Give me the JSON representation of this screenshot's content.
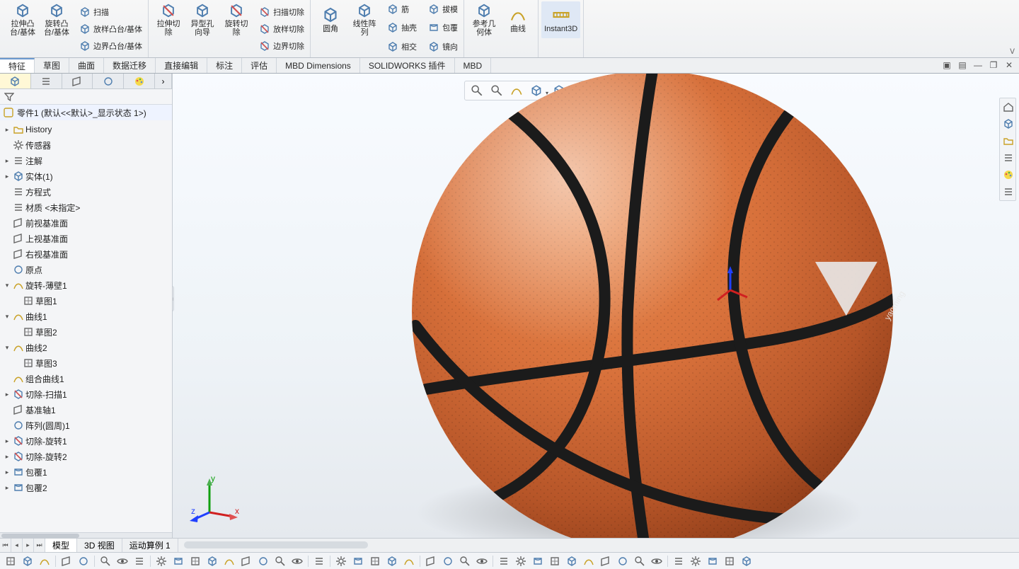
{
  "ribbon": {
    "groups": [
      {
        "big": [
          {
            "id": "extrude-boss",
            "label": "拉伸凸\n台/基体"
          },
          {
            "id": "revolve-boss",
            "label": "旋转凸\n台/基体"
          }
        ],
        "small": [
          {
            "id": "sweep",
            "label": "扫描"
          },
          {
            "id": "loft",
            "label": "放样凸台/基体"
          },
          {
            "id": "boundary",
            "label": "边界凸台/基体"
          }
        ]
      },
      {
        "big": [
          {
            "id": "extrude-cut",
            "label": "拉伸切\n除"
          },
          {
            "id": "hole-wizard",
            "label": "异型孔\n向导"
          },
          {
            "id": "revolve-cut",
            "label": "旋转切\n除"
          }
        ],
        "small": [
          {
            "id": "sweep-cut",
            "label": "扫描切除"
          },
          {
            "id": "loft-cut",
            "label": "放样切除"
          },
          {
            "id": "boundary-cut",
            "label": "边界切除"
          }
        ]
      },
      {
        "big": [
          {
            "id": "fillet",
            "label": "圆角"
          },
          {
            "id": "linear-pattern",
            "label": "线性阵\n列"
          }
        ],
        "small": [
          {
            "id": "rib",
            "label": "筋"
          },
          {
            "id": "draft",
            "label": "拔模"
          },
          {
            "id": "shell",
            "label": "抽壳"
          },
          {
            "id": "wrap",
            "label": "包覆"
          },
          {
            "id": "intersect",
            "label": "相交"
          },
          {
            "id": "mirror",
            "label": "镜向"
          }
        ]
      },
      {
        "big": [
          {
            "id": "ref-geom",
            "label": "参考几\n何体"
          },
          {
            "id": "curves",
            "label": "曲线"
          }
        ],
        "small": []
      },
      {
        "big": [
          {
            "id": "instant3d",
            "label": "Instant3D"
          }
        ],
        "small": [],
        "active": true
      }
    ]
  },
  "tabs": [
    "特征",
    "草图",
    "曲面",
    "数据迁移",
    "直接编辑",
    "标注",
    "评估",
    "MBD Dimensions",
    "SOLIDWORKS 插件",
    "MBD"
  ],
  "activeTab": 0,
  "panelTabs": [
    "feature-tree",
    "property",
    "config",
    "display",
    "appearance"
  ],
  "rootNode": "零件1  (默认<<默认>_显示状态 1>)",
  "tree": [
    {
      "d": 0,
      "tw": "▸",
      "ic": "history",
      "t": "History"
    },
    {
      "d": 0,
      "tw": "",
      "ic": "sensor",
      "t": "传感器"
    },
    {
      "d": 0,
      "tw": "▸",
      "ic": "annot",
      "t": "注解"
    },
    {
      "d": 0,
      "tw": "▸",
      "ic": "solid",
      "t": "实体(1)"
    },
    {
      "d": 0,
      "tw": "",
      "ic": "eqn",
      "t": "方程式"
    },
    {
      "d": 0,
      "tw": "",
      "ic": "mat",
      "t": "材质 <未指定>"
    },
    {
      "d": 0,
      "tw": "",
      "ic": "plane",
      "t": "前视基准面"
    },
    {
      "d": 0,
      "tw": "",
      "ic": "plane",
      "t": "上视基准面"
    },
    {
      "d": 0,
      "tw": "",
      "ic": "plane",
      "t": "右视基准面"
    },
    {
      "d": 0,
      "tw": "",
      "ic": "origin",
      "t": "原点"
    },
    {
      "d": 0,
      "tw": "▾",
      "ic": "revolve",
      "t": "旋转-薄壁1"
    },
    {
      "d": 1,
      "tw": "",
      "ic": "sketch",
      "t": "草图1"
    },
    {
      "d": 0,
      "tw": "▾",
      "ic": "curve",
      "t": "曲线1"
    },
    {
      "d": 1,
      "tw": "",
      "ic": "sketch",
      "t": "草图2"
    },
    {
      "d": 0,
      "tw": "▾",
      "ic": "curve",
      "t": "曲线2"
    },
    {
      "d": 1,
      "tw": "",
      "ic": "sketch",
      "t": "草图3"
    },
    {
      "d": 0,
      "tw": "",
      "ic": "comp",
      "t": "组合曲线1"
    },
    {
      "d": 0,
      "tw": "▸",
      "ic": "cut",
      "t": "切除-扫描1"
    },
    {
      "d": 0,
      "tw": "",
      "ic": "axis",
      "t": "基准轴1"
    },
    {
      "d": 0,
      "tw": "",
      "ic": "circ",
      "t": "阵列(圆周)1"
    },
    {
      "d": 0,
      "tw": "▸",
      "ic": "cutrev",
      "t": "切除-旋转1"
    },
    {
      "d": 0,
      "tw": "▸",
      "ic": "cutrev",
      "t": "切除-旋转2"
    },
    {
      "d": 0,
      "tw": "▸",
      "ic": "wrap",
      "t": "包覆1"
    },
    {
      "d": 0,
      "tw": "▸",
      "ic": "wrap",
      "t": "包覆2"
    }
  ],
  "bottomTabs": [
    "模型",
    "3D 视图",
    "运动算例 1"
  ],
  "activeBottomTab": 0,
  "logoText": "yaoming",
  "triad": {
    "x": "x",
    "y": "y",
    "z": "z"
  }
}
